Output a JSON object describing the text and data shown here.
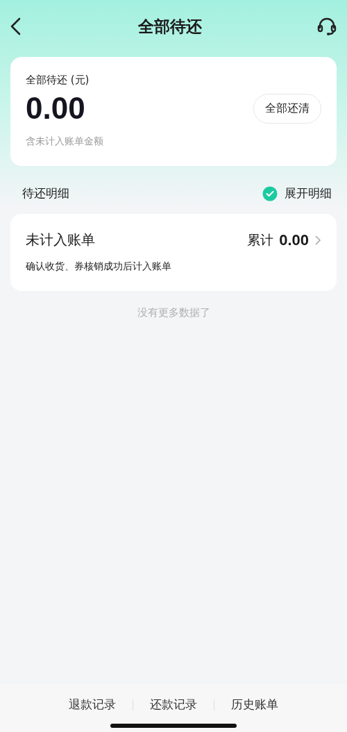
{
  "header": {
    "title": "全部待还"
  },
  "summary": {
    "label": "全部待还 (元)",
    "amount": "0.00",
    "button": "全部还清",
    "note": "含未计入账单金额"
  },
  "details": {
    "title": "待还明细",
    "toggle": {
      "label": "展开明细",
      "checked": true
    }
  },
  "bills": [
    {
      "title": "未计入账单",
      "total_label": "累计",
      "total": "0.00",
      "description": "确认收货、券核销成功后计入账单"
    }
  ],
  "end_note": "没有更多数据了",
  "footer_links": [
    "退款记录",
    "还款记录",
    "历史账单"
  ]
}
